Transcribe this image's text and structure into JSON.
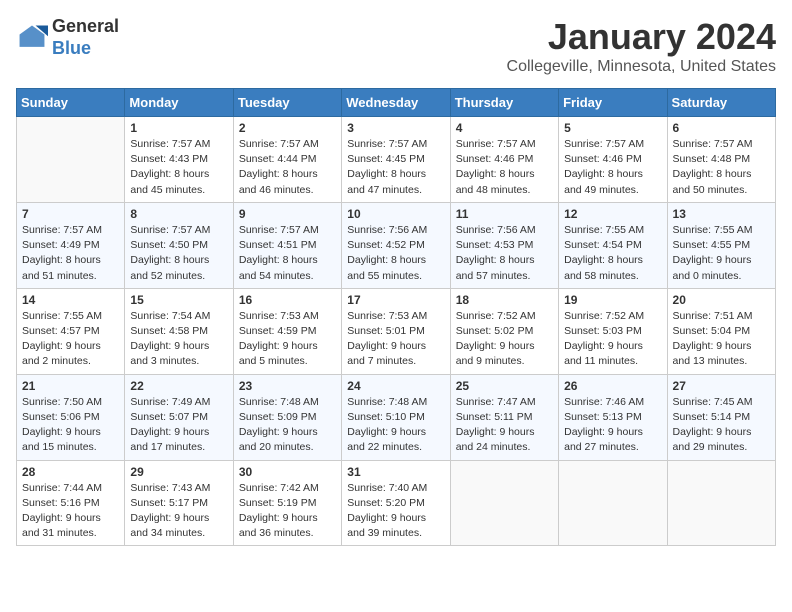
{
  "header": {
    "logo_general": "General",
    "logo_blue": "Blue",
    "title": "January 2024",
    "subtitle": "Collegeville, Minnesota, United States"
  },
  "days_of_week": [
    "Sunday",
    "Monday",
    "Tuesday",
    "Wednesday",
    "Thursday",
    "Friday",
    "Saturday"
  ],
  "weeks": [
    [
      {
        "day": "",
        "info": ""
      },
      {
        "day": "1",
        "info": "Sunrise: 7:57 AM\nSunset: 4:43 PM\nDaylight: 8 hours\nand 45 minutes."
      },
      {
        "day": "2",
        "info": "Sunrise: 7:57 AM\nSunset: 4:44 PM\nDaylight: 8 hours\nand 46 minutes."
      },
      {
        "day": "3",
        "info": "Sunrise: 7:57 AM\nSunset: 4:45 PM\nDaylight: 8 hours\nand 47 minutes."
      },
      {
        "day": "4",
        "info": "Sunrise: 7:57 AM\nSunset: 4:46 PM\nDaylight: 8 hours\nand 48 minutes."
      },
      {
        "day": "5",
        "info": "Sunrise: 7:57 AM\nSunset: 4:46 PM\nDaylight: 8 hours\nand 49 minutes."
      },
      {
        "day": "6",
        "info": "Sunrise: 7:57 AM\nSunset: 4:48 PM\nDaylight: 8 hours\nand 50 minutes."
      }
    ],
    [
      {
        "day": "7",
        "info": "Sunrise: 7:57 AM\nSunset: 4:49 PM\nDaylight: 8 hours\nand 51 minutes."
      },
      {
        "day": "8",
        "info": "Sunrise: 7:57 AM\nSunset: 4:50 PM\nDaylight: 8 hours\nand 52 minutes."
      },
      {
        "day": "9",
        "info": "Sunrise: 7:57 AM\nSunset: 4:51 PM\nDaylight: 8 hours\nand 54 minutes."
      },
      {
        "day": "10",
        "info": "Sunrise: 7:56 AM\nSunset: 4:52 PM\nDaylight: 8 hours\nand 55 minutes."
      },
      {
        "day": "11",
        "info": "Sunrise: 7:56 AM\nSunset: 4:53 PM\nDaylight: 8 hours\nand 57 minutes."
      },
      {
        "day": "12",
        "info": "Sunrise: 7:55 AM\nSunset: 4:54 PM\nDaylight: 8 hours\nand 58 minutes."
      },
      {
        "day": "13",
        "info": "Sunrise: 7:55 AM\nSunset: 4:55 PM\nDaylight: 9 hours\nand 0 minutes."
      }
    ],
    [
      {
        "day": "14",
        "info": "Sunrise: 7:55 AM\nSunset: 4:57 PM\nDaylight: 9 hours\nand 2 minutes."
      },
      {
        "day": "15",
        "info": "Sunrise: 7:54 AM\nSunset: 4:58 PM\nDaylight: 9 hours\nand 3 minutes."
      },
      {
        "day": "16",
        "info": "Sunrise: 7:53 AM\nSunset: 4:59 PM\nDaylight: 9 hours\nand 5 minutes."
      },
      {
        "day": "17",
        "info": "Sunrise: 7:53 AM\nSunset: 5:01 PM\nDaylight: 9 hours\nand 7 minutes."
      },
      {
        "day": "18",
        "info": "Sunrise: 7:52 AM\nSunset: 5:02 PM\nDaylight: 9 hours\nand 9 minutes."
      },
      {
        "day": "19",
        "info": "Sunrise: 7:52 AM\nSunset: 5:03 PM\nDaylight: 9 hours\nand 11 minutes."
      },
      {
        "day": "20",
        "info": "Sunrise: 7:51 AM\nSunset: 5:04 PM\nDaylight: 9 hours\nand 13 minutes."
      }
    ],
    [
      {
        "day": "21",
        "info": "Sunrise: 7:50 AM\nSunset: 5:06 PM\nDaylight: 9 hours\nand 15 minutes."
      },
      {
        "day": "22",
        "info": "Sunrise: 7:49 AM\nSunset: 5:07 PM\nDaylight: 9 hours\nand 17 minutes."
      },
      {
        "day": "23",
        "info": "Sunrise: 7:48 AM\nSunset: 5:09 PM\nDaylight: 9 hours\nand 20 minutes."
      },
      {
        "day": "24",
        "info": "Sunrise: 7:48 AM\nSunset: 5:10 PM\nDaylight: 9 hours\nand 22 minutes."
      },
      {
        "day": "25",
        "info": "Sunrise: 7:47 AM\nSunset: 5:11 PM\nDaylight: 9 hours\nand 24 minutes."
      },
      {
        "day": "26",
        "info": "Sunrise: 7:46 AM\nSunset: 5:13 PM\nDaylight: 9 hours\nand 27 minutes."
      },
      {
        "day": "27",
        "info": "Sunrise: 7:45 AM\nSunset: 5:14 PM\nDaylight: 9 hours\nand 29 minutes."
      }
    ],
    [
      {
        "day": "28",
        "info": "Sunrise: 7:44 AM\nSunset: 5:16 PM\nDaylight: 9 hours\nand 31 minutes."
      },
      {
        "day": "29",
        "info": "Sunrise: 7:43 AM\nSunset: 5:17 PM\nDaylight: 9 hours\nand 34 minutes."
      },
      {
        "day": "30",
        "info": "Sunrise: 7:42 AM\nSunset: 5:19 PM\nDaylight: 9 hours\nand 36 minutes."
      },
      {
        "day": "31",
        "info": "Sunrise: 7:40 AM\nSunset: 5:20 PM\nDaylight: 9 hours\nand 39 minutes."
      },
      {
        "day": "",
        "info": ""
      },
      {
        "day": "",
        "info": ""
      },
      {
        "day": "",
        "info": ""
      }
    ]
  ]
}
